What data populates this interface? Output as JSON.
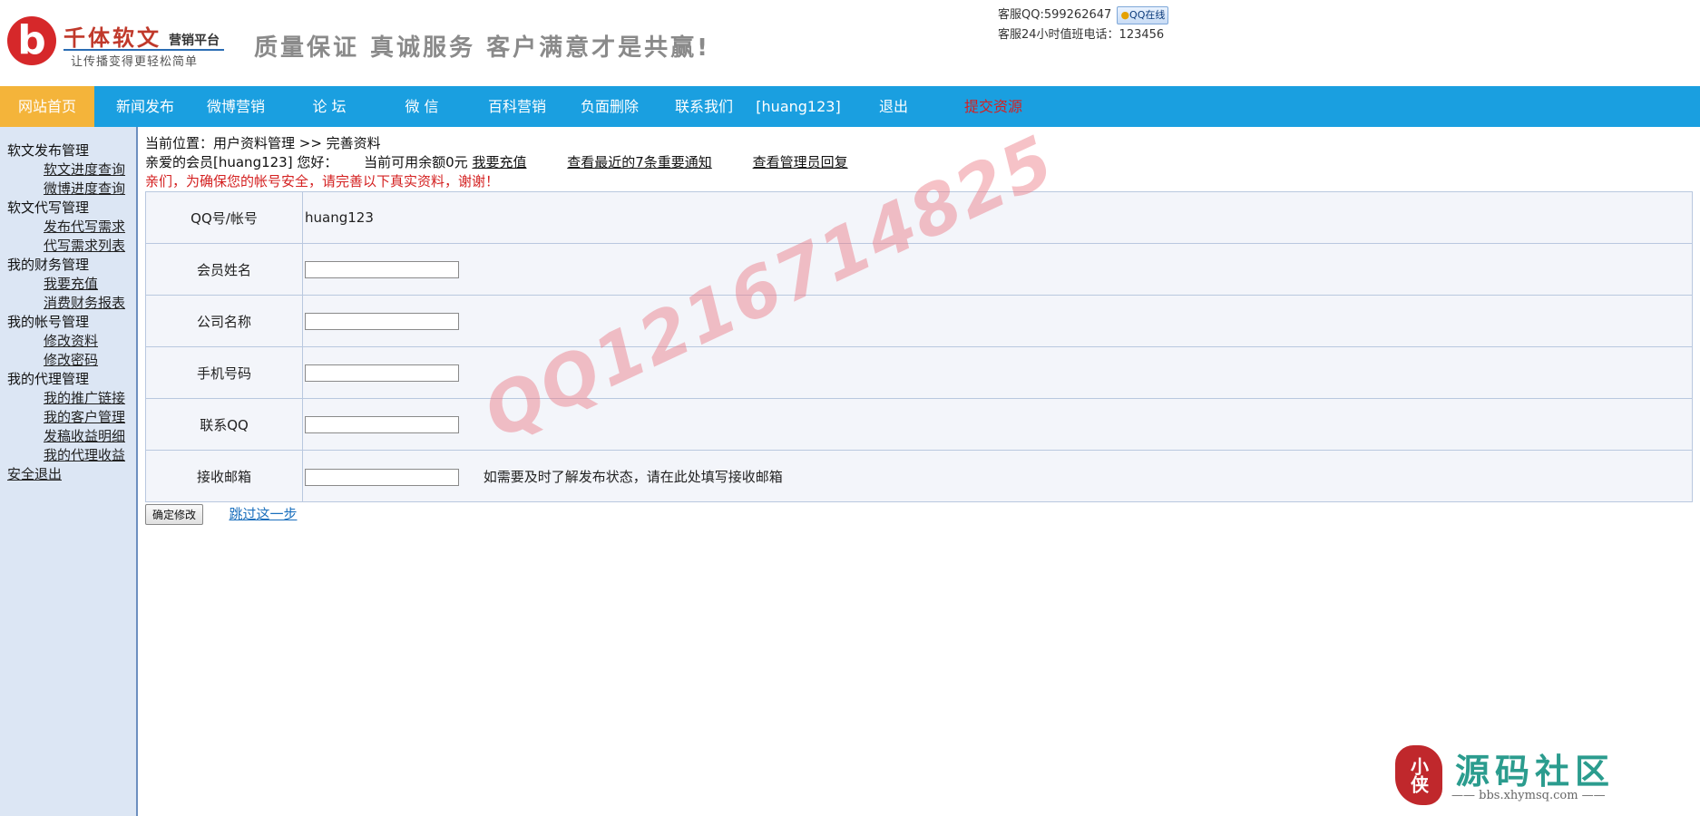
{
  "header": {
    "logo_letter": "b",
    "logo_name": "千体软文",
    "logo_sub": "营销平台",
    "logo_slogan": "让传播变得更轻松简单",
    "headline": "质量保证 真诚服务 客户满意才是共赢!",
    "contact_qq": "客服QQ:599262647",
    "qq_button": "QQ在线",
    "contact_phone": "客服24小时值班电话：123456"
  },
  "nav": {
    "items": [
      {
        "label": "网站首页"
      },
      {
        "label": "新闻发布"
      },
      {
        "label": "微博营销"
      },
      {
        "label": "论 坛"
      },
      {
        "label": "微 信"
      },
      {
        "label": "百科营销"
      },
      {
        "label": "负面删除"
      },
      {
        "label": "联系我们"
      },
      {
        "label": "[huang123]"
      },
      {
        "label": "退出"
      },
      {
        "label": "提交资源"
      }
    ]
  },
  "sidebar": {
    "groups": [
      {
        "title": "软文发布管理",
        "links": [
          "软文进度查询",
          "微博进度查询"
        ]
      },
      {
        "title": "软文代写管理",
        "links": [
          "发布代写需求",
          "代写需求列表"
        ]
      },
      {
        "title": "我的财务管理",
        "links": [
          "我要充值",
          "消费财务报表"
        ]
      },
      {
        "title": "我的帐号管理",
        "links": [
          "修改资料",
          "修改密码"
        ]
      },
      {
        "title": "我的代理管理",
        "links": [
          "我的推广链接",
          "我的客户管理",
          "发稿收益明细",
          "我的代理收益"
        ]
      }
    ],
    "exit": "安全退出"
  },
  "main": {
    "breadcrumb": "当前位置：用户资料管理 >> 完善资料",
    "greeting": "亲爱的会员[huang123] 您好：",
    "balance": "当前可用余额0元",
    "recharge": "我要充值",
    "notices": "查看最近的7条重要通知",
    "admin_reply": "查看管理员回复",
    "warning": "亲们，为确保您的帐号安全，请完善以下真实资料，谢谢！",
    "form": {
      "account_label": "QQ号/帐号",
      "account_value": "huang123",
      "name_label": "会员姓名",
      "company_label": "公司名称",
      "phone_label": "手机号码",
      "qq_label": "联系QQ",
      "email_label": "接收邮箱",
      "email_hint": "如需要及时了解发布状态，请在此处填写接收邮箱"
    },
    "submit": "确定修改",
    "skip": "跳过这一步"
  },
  "watermark": "QQ1216714825",
  "brand": {
    "seal": "小侠",
    "name": "源码社区",
    "url": "—— bbs.xhymsq.com ——"
  }
}
